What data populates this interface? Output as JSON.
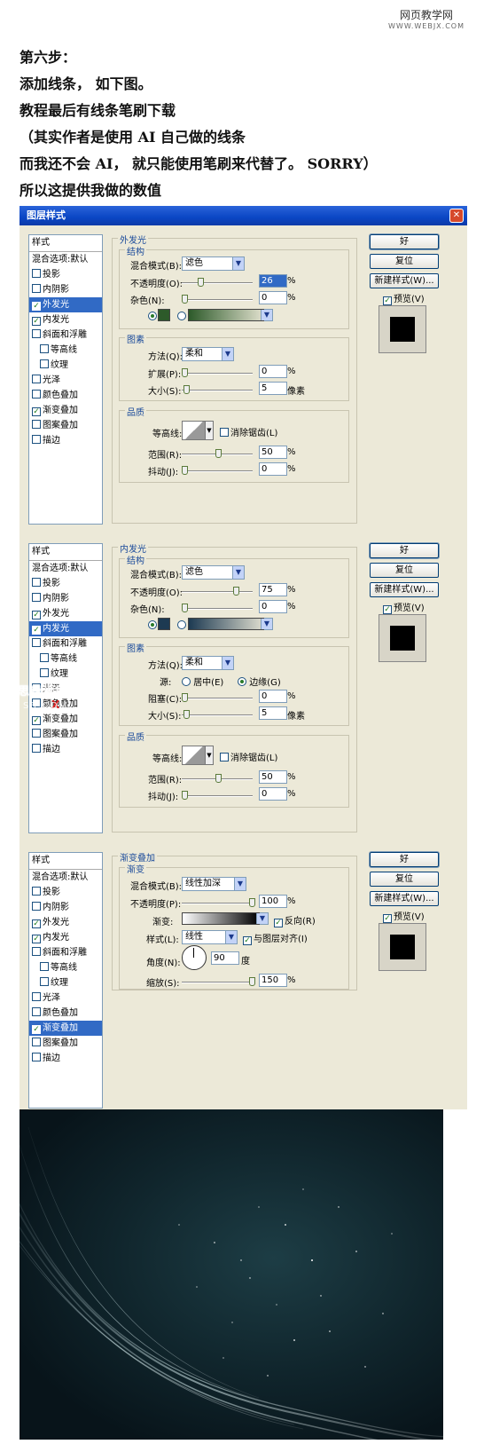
{
  "watermark": {
    "site": "网页教学网",
    "url": "WWW.WEBJX.COM"
  },
  "intro_lines": [
    "第六步：",
    "添加线条，  如下图。",
    "教程最后有线条笔刷下载",
    "（其实作者是使用 AI 自己做的线条",
    "而我还不会 AI，  就只能使用笔刷来代替了。 SORRY）",
    "所以这提供我做的数值"
  ],
  "dialog": {
    "title": "图层样式",
    "close": "✕"
  },
  "common": {
    "styles_header": "样式",
    "blend_options": "混合选项:默认",
    "items": [
      "投影",
      "内阴影",
      "外发光",
      "内发光",
      "斜面和浮雕",
      "等高线",
      "纹理",
      "光泽",
      "颜色叠加",
      "渐变叠加",
      "图案叠加",
      "描边"
    ],
    "ok": "好",
    "reset": "复位",
    "new_style": "新建样式(W)...",
    "preview": "预览(V)",
    "structure": "结构",
    "elements": "图素",
    "quality": "品质",
    "blend_mode": "混合模式(B):",
    "opacity": "不透明度(O):",
    "noise": "杂色(N):",
    "technique": "方法(Q):",
    "spread": "扩展(P):",
    "size": "大小(S):",
    "contour": "等高线:",
    "antialias": "消除锯齿(L)",
    "range": "范围(R):",
    "jitter": "抖动(J):",
    "pct": "%",
    "px": "像素",
    "source": "源:",
    "center": "居中(E)",
    "edge": "边缘(G)",
    "choke": "阻塞(C):"
  },
  "d1": {
    "section": "外发光",
    "blend": "滤色",
    "opacity": "26",
    "noise": "0",
    "technique": "柔和",
    "spread": "0",
    "size": "5",
    "range": "50",
    "jitter": "0",
    "color": "#2d5a2a"
  },
  "d2": {
    "section": "内发光",
    "blend": "滤色",
    "opacity": "75",
    "noise": "0",
    "technique": "柔和",
    "choke": "0",
    "size": "5",
    "range": "50",
    "jitter": "0",
    "color": "#1d3a52"
  },
  "d3": {
    "section": "渐变叠加",
    "sub": "渐变",
    "blend": "线性加深",
    "opacity_label": "不透明度(P):",
    "opacity": "100",
    "gradient_label": "渐变:",
    "reverse": "反向(R)",
    "style_label": "样式(L):",
    "style": "线性",
    "align": "与图层对齐(I)",
    "angle_label": "角度(N):",
    "angle": "90",
    "deg": "度",
    "scale_label": "缩放(S):",
    "scale": "150"
  },
  "overlay_watermark": {
    "t1": "思缘论坛",
    "t2": "SS.COM",
    "x": "X"
  }
}
